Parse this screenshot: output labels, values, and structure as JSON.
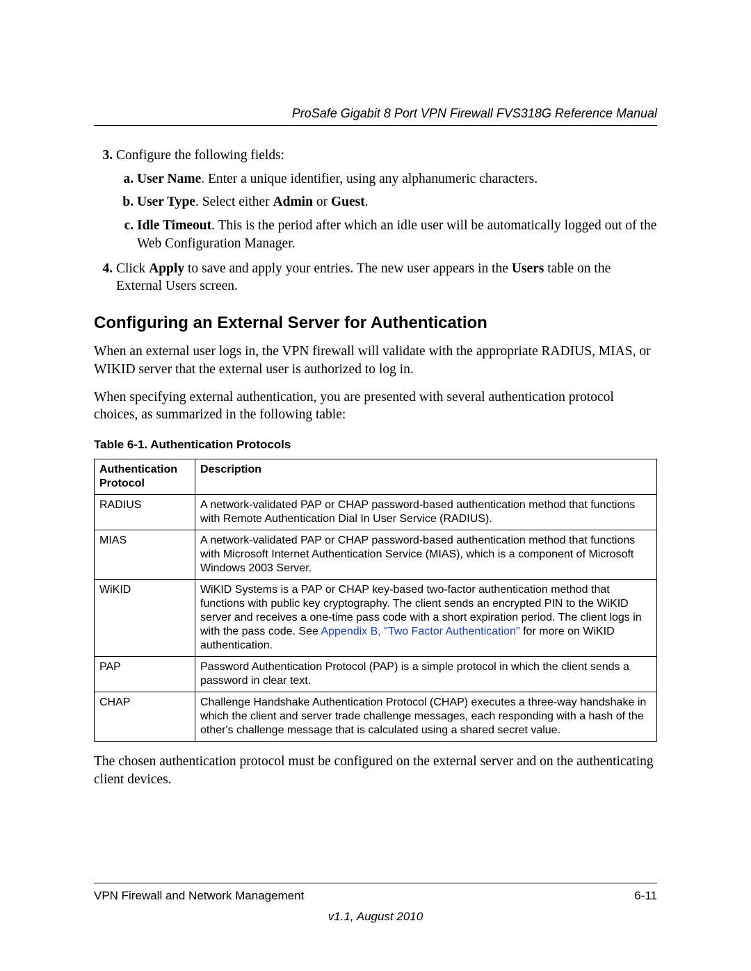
{
  "header": {
    "running_title": "ProSafe Gigabit 8 Port VPN Firewall FVS318G Reference Manual"
  },
  "steps": {
    "step3": {
      "marker": "3.",
      "text": "Configure the following fields:",
      "sub": {
        "a_label": "User Name",
        "a_rest": ". Enter a unique identifier, using any alphanumeric characters.",
        "b_label": "User Type",
        "b_mid": ". Select either ",
        "b_admin": "Admin",
        "b_or": " or ",
        "b_guest": "Guest",
        "b_end": ".",
        "c_label": "Idle Timeout",
        "c_rest": ". This is the period after which an idle user will be automatically logged out of the Web Configuration Manager."
      }
    },
    "step4": {
      "marker": "4.",
      "pre": "Click ",
      "apply": "Apply",
      "mid": " to save and apply your entries. The new user appears in the ",
      "users": "Users",
      "post": " table on the External Users screen."
    }
  },
  "section": {
    "heading": "Configuring an External Server for Authentication",
    "para1": "When an external user logs in, the VPN firewall will validate with the appropriate RADIUS, MIAS, or WIKID server that the external user is authorized to log in.",
    "para2": "When specifying external authentication, you are presented with several authentication protocol choices, as summarized in the following table:"
  },
  "table": {
    "caption": "Table 6-1. Authentication Protocols",
    "head": {
      "c1": "Authentication Protocol",
      "c2": "Description"
    },
    "rows": [
      {
        "name": "RADIUS",
        "desc": "A network-validated PAP or CHAP password-based authentication method that functions with Remote Authentication Dial In User Service (RADIUS)."
      },
      {
        "name": "MIAS",
        "desc": "A network-validated PAP or CHAP password-based authentication method that functions with Microsoft Internet Authentication Service (MIAS), which is a component of Microsoft Windows 2003 Server."
      },
      {
        "name": "WiKID",
        "desc_pre": "WiKID Systems is a PAP or CHAP key-based two-factor authentication method that functions with public key cryptography. The client sends an encrypted PIN to the WiKID server and receives a one-time pass code with a short expiration period. The client logs in with the pass code. See ",
        "desc_link": "Appendix B, \"Two Factor Authentication\"",
        "desc_post": " for more on WiKID authentication."
      },
      {
        "name": "PAP",
        "desc": "Password Authentication Protocol (PAP) is a simple protocol in which the client sends a password in clear text."
      },
      {
        "name": "CHAP",
        "desc": "Challenge Handshake Authentication Protocol (CHAP) executes a three-way handshake in which the client and server trade challenge messages, each responding with a hash of the other's challenge message that is calculated using a shared secret value."
      }
    ]
  },
  "closing": "The chosen authentication protocol must be configured on the external server and on the authenticating client devices.",
  "footer": {
    "left": "VPN Firewall and Network Management",
    "right": "6-11",
    "version": "v1.1, August 2010"
  }
}
